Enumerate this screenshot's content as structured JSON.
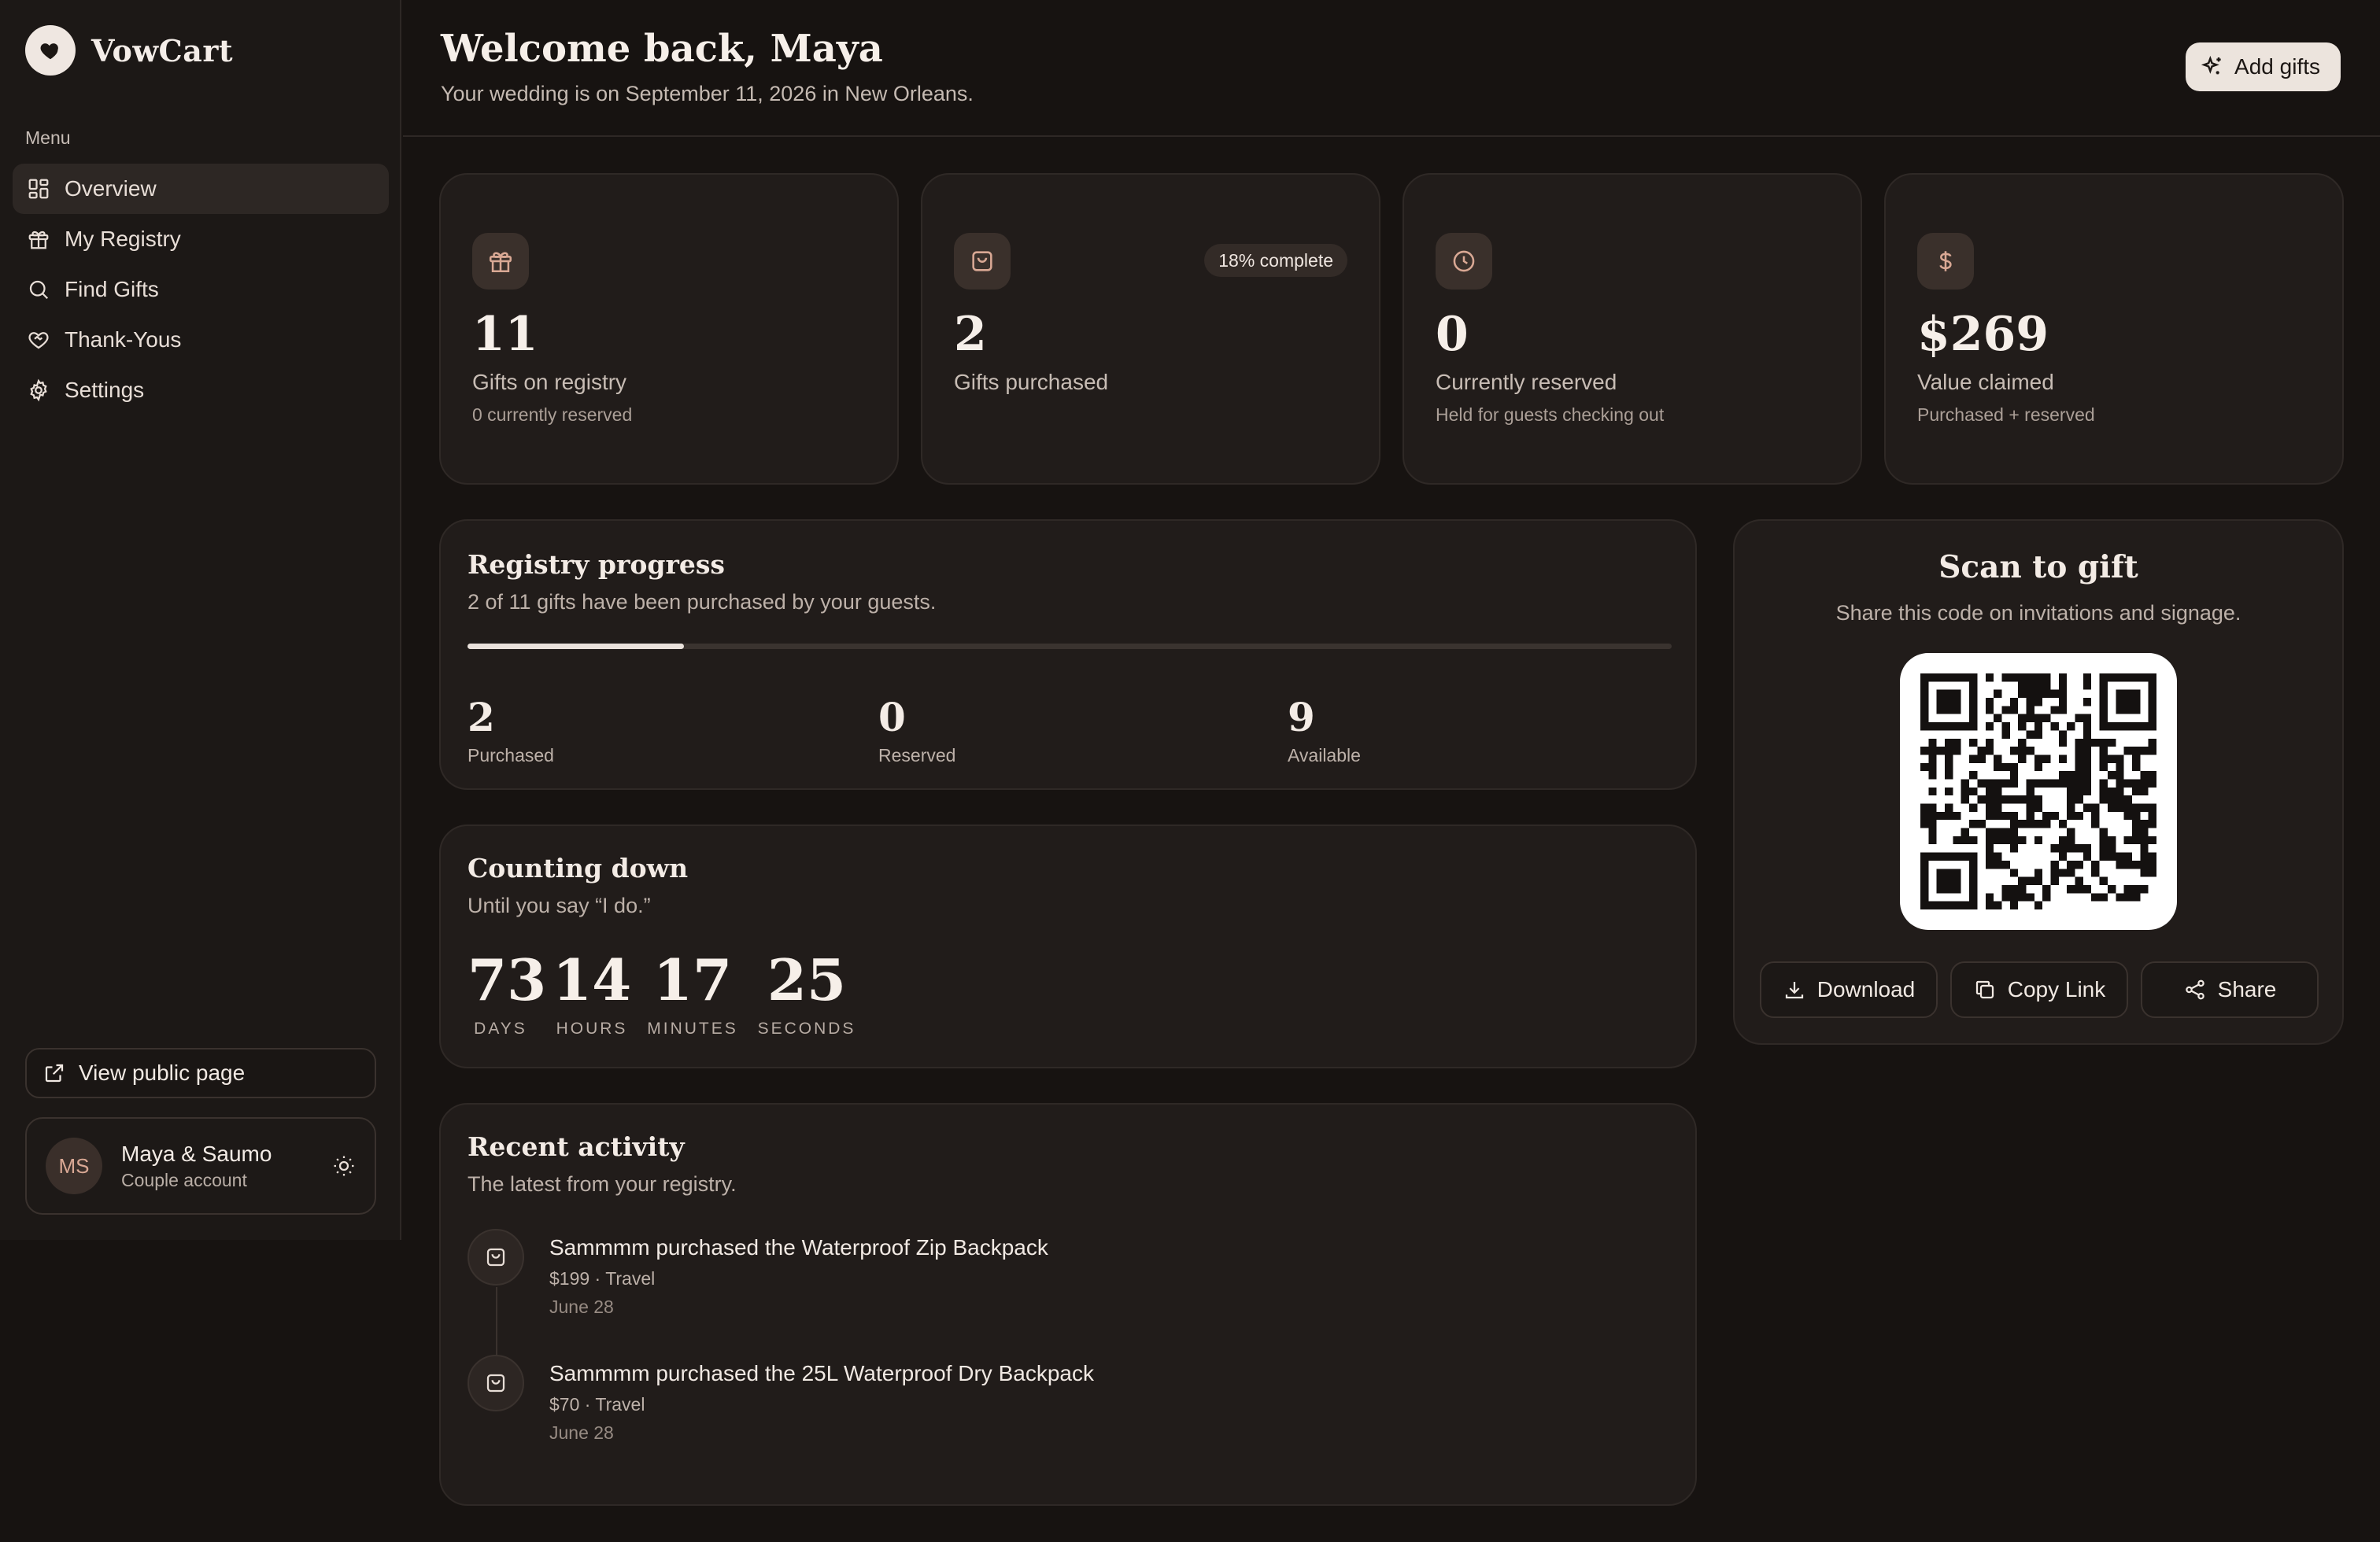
{
  "app": {
    "name": "VowCart"
  },
  "sidebar": {
    "menu_label": "Menu",
    "items": [
      {
        "label": "Overview",
        "icon": "dashboard-icon",
        "active": true
      },
      {
        "label": "My Registry",
        "icon": "gift-icon"
      },
      {
        "label": "Find Gifts",
        "icon": "search-icon"
      },
      {
        "label": "Thank-Yous",
        "icon": "heart-handshake-icon"
      },
      {
        "label": "Settings",
        "icon": "gear-icon"
      }
    ],
    "public_page_label": "View public page",
    "account": {
      "initials": "MS",
      "name": "Maya & Saumo",
      "type": "Couple account"
    }
  },
  "header": {
    "title": "Welcome back, Maya",
    "subtitle": "Your wedding is on September 11, 2026 in New Orleans.",
    "add_gifts_label": "Add gifts"
  },
  "stats": [
    {
      "value": "11",
      "label": "Gifts on registry",
      "sub": "0 currently reserved",
      "icon": "gift-icon"
    },
    {
      "value": "2",
      "label": "Gifts purchased",
      "sub": "",
      "badge": "18% complete",
      "icon": "bag-icon"
    },
    {
      "value": "0",
      "label": "Currently reserved",
      "sub": "Held for guests checking out",
      "icon": "clock-icon"
    },
    {
      "value": "$269",
      "label": "Value claimed",
      "sub": "Purchased + reserved",
      "icon": "dollar-icon"
    }
  ],
  "progress": {
    "title": "Registry progress",
    "subtitle": "2 of 11 gifts have been purchased by your guests.",
    "fraction": 0.18,
    "stats": [
      {
        "value": "2",
        "label": "Purchased"
      },
      {
        "value": "0",
        "label": "Reserved"
      },
      {
        "value": "9",
        "label": "Available"
      }
    ]
  },
  "countdown": {
    "title": "Counting down",
    "subtitle": "Until you say “I do.”",
    "units": [
      {
        "value": "73",
        "label": "DAYS"
      },
      {
        "value": "14",
        "label": "HOURS"
      },
      {
        "value": "17",
        "label": "MINUTES"
      },
      {
        "value": "25",
        "label": "SECONDS"
      }
    ]
  },
  "activity": {
    "title": "Recent activity",
    "subtitle": "The latest from your registry.",
    "items": [
      {
        "title": "Sammmm purchased the Waterproof Zip Backpack",
        "meta": "$199 · Travel",
        "date": "June 28"
      },
      {
        "title": "Sammmm purchased the 25L Waterproof Dry Backpack",
        "meta": "$70 · Travel",
        "date": "June 28"
      }
    ]
  },
  "qr": {
    "title": "Scan to gift",
    "subtitle": "Share this code on invitations and signage.",
    "buttons": {
      "download": "Download",
      "copy": "Copy Link",
      "share": "Share"
    }
  },
  "colors": {
    "background": "#171311",
    "card": "#211c1a",
    "accent_icon": "#d9a894",
    "text": "#efe7e1"
  }
}
